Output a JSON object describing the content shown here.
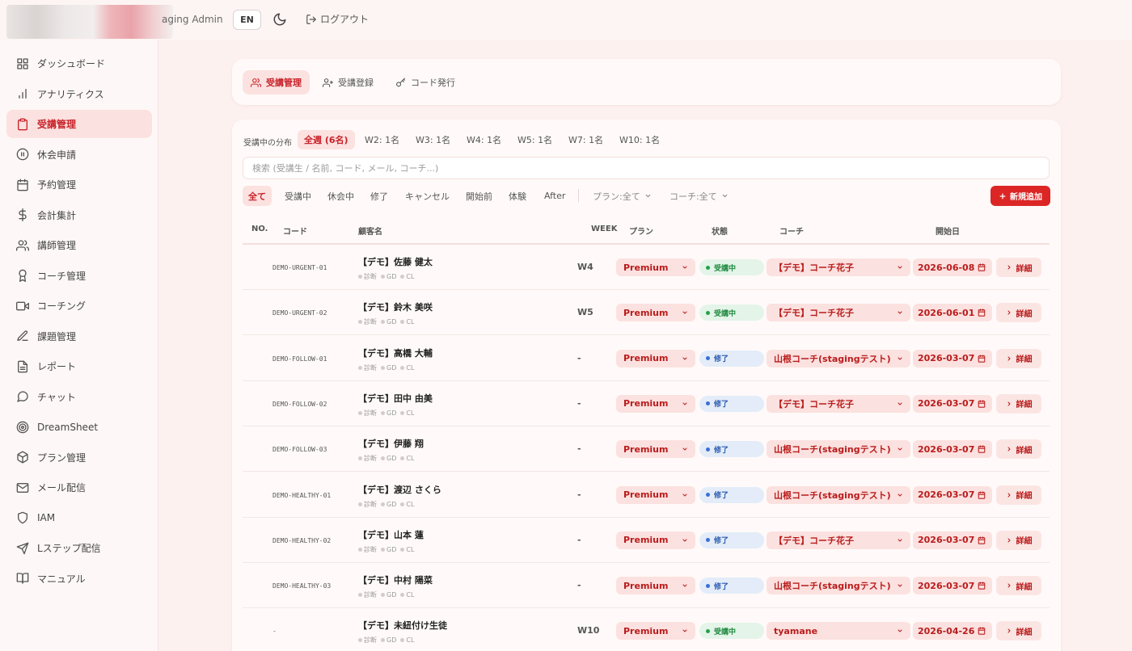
{
  "topbar": {
    "title": "aging Admin",
    "lang": "EN",
    "logout": "ログアウト"
  },
  "sidebar": {
    "items": [
      {
        "label": "ダッシュボード",
        "icon": "grid-icon"
      },
      {
        "label": "アナリティクス",
        "icon": "bar-chart-icon"
      },
      {
        "label": "受講管理",
        "icon": "clipboard-icon",
        "active": true
      },
      {
        "label": "休会申請",
        "icon": "pause-circle-icon"
      },
      {
        "label": "予約管理",
        "icon": "calendar-icon"
      },
      {
        "label": "会計集計",
        "icon": "dollar-icon"
      },
      {
        "label": "講師管理",
        "icon": "users-icon"
      },
      {
        "label": "コーチ管理",
        "icon": "award-icon"
      },
      {
        "label": "コーチング",
        "icon": "video-icon"
      },
      {
        "label": "課題管理",
        "icon": "pencil-icon"
      },
      {
        "label": "レポート",
        "icon": "file-text-icon"
      },
      {
        "label": "チャット",
        "icon": "chat-icon"
      },
      {
        "label": "DreamSheet",
        "icon": "target-icon"
      },
      {
        "label": "プラン管理",
        "icon": "package-icon"
      },
      {
        "label": "メール配信",
        "icon": "mail-icon"
      },
      {
        "label": "IAM",
        "icon": "shield-icon"
      },
      {
        "label": "Lステップ配信",
        "icon": "send-icon"
      },
      {
        "label": "マニュアル",
        "icon": "book-icon"
      }
    ]
  },
  "tabs": [
    {
      "label": "受講管理",
      "icon": "users-icon",
      "active": true
    },
    {
      "label": "受講登録",
      "icon": "user-plus-icon"
    },
    {
      "label": "コード発行",
      "icon": "key-icon"
    }
  ],
  "distribution": {
    "label": "受講中の分布",
    "items": [
      "全週 (6名)",
      "W2: 1名",
      "W3: 1名",
      "W4: 1名",
      "W5: 1名",
      "W7: 1名",
      "W10: 1名"
    ]
  },
  "search": {
    "placeholder": "検索 (受講生 / 名前, コード, メール, コーチ...)"
  },
  "filters": [
    "全て",
    "受講中",
    "休会中",
    "修了",
    "キャンセル",
    "開始前",
    "体験",
    "After"
  ],
  "dropdowns": {
    "plan": "プラン:全て",
    "coach": "コーチ:全て"
  },
  "new_button": "新規追加",
  "table": {
    "headers": {
      "no": "NO.",
      "code": "コード",
      "name": "顧客名",
      "week": "WEEK",
      "plan": "プラン",
      "status": "状態",
      "coach": "コーチ",
      "start": "開始日"
    },
    "sub_labels": [
      "診断",
      "GD",
      "CL"
    ],
    "detail_label": "詳細",
    "rows": [
      {
        "code": "DEMO-URGENT-01",
        "name": "【デモ】佐藤 健太",
        "week": "W4",
        "plan": "Premium",
        "status": "受講中",
        "status_type": "green",
        "coach": "【デモ】コーチ花子",
        "start": "2026-06-08"
      },
      {
        "code": "DEMO-URGENT-02",
        "name": "【デモ】鈴木 美咲",
        "week": "W5",
        "plan": "Premium",
        "status": "受講中",
        "status_type": "green",
        "coach": "【デモ】コーチ花子",
        "start": "2026-06-01"
      },
      {
        "code": "DEMO-FOLLOW-01",
        "name": "【デモ】高橋 大輔",
        "week": "-",
        "plan": "Premium",
        "status": "修了",
        "status_type": "blue",
        "coach": "山根コーチ(stagingテスト)",
        "start": "2026-03-07"
      },
      {
        "code": "DEMO-FOLLOW-02",
        "name": "【デモ】田中 由美",
        "week": "-",
        "plan": "Premium",
        "status": "修了",
        "status_type": "blue",
        "coach": "【デモ】コーチ花子",
        "start": "2026-03-07"
      },
      {
        "code": "DEMO-FOLLOW-03",
        "name": "【デモ】伊藤 翔",
        "week": "-",
        "plan": "Premium",
        "status": "修了",
        "status_type": "blue",
        "coach": "山根コーチ(stagingテスト)",
        "start": "2026-03-07"
      },
      {
        "code": "DEMO-HEALTHY-01",
        "name": "【デモ】渡辺 さくら",
        "week": "-",
        "plan": "Premium",
        "status": "修了",
        "status_type": "blue",
        "coach": "山根コーチ(stagingテスト)",
        "start": "2026-03-07"
      },
      {
        "code": "DEMO-HEALTHY-02",
        "name": "【デモ】山本 蓮",
        "week": "-",
        "plan": "Premium",
        "status": "修了",
        "status_type": "blue",
        "coach": "【デモ】コーチ花子",
        "start": "2026-03-07"
      },
      {
        "code": "DEMO-HEALTHY-03",
        "name": "【デモ】中村 陽菜",
        "week": "-",
        "plan": "Premium",
        "status": "修了",
        "status_type": "blue",
        "coach": "山根コーチ(stagingテスト)",
        "start": "2026-03-07"
      },
      {
        "code": "-",
        "name": "【デモ】未紐付け生徒",
        "week": "W10",
        "plan": "Premium",
        "status": "受講中",
        "status_type": "green",
        "coach": "tyamane",
        "start": "2026-04-26"
      }
    ]
  },
  "colors": {
    "accent": "#c8222a",
    "accent_bg": "#fbe1df",
    "page_bg": "#fdf1ef",
    "new_button": "#dc2626"
  }
}
